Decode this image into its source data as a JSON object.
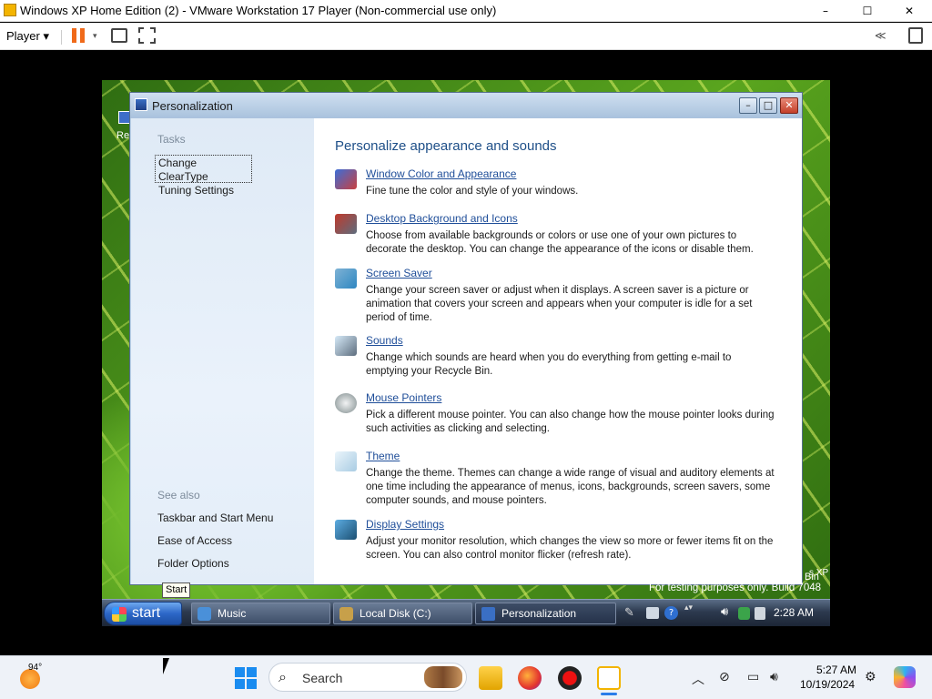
{
  "host_window": {
    "title": "Windows XP Home Edition (2) - VMware Workstation 17 Player (Non-commercial use only)",
    "minimize_glyph": "–",
    "maximize_glyph": "☐",
    "close_glyph": "✕",
    "player_menu": "Player",
    "player_menu_arrow": "▾"
  },
  "toolbar_icons": [
    "pause-icon",
    "send-ctrl-alt-del-icon",
    "fit-guest-icon",
    "unity-icon",
    "library-icon"
  ],
  "guest": {
    "desktop_icon_label": "Re",
    "window": {
      "title": "Personalization",
      "buttons": {
        "minimize": "–",
        "maximize": "□",
        "close": "✕"
      },
      "sidebar": {
        "tasks_heading": "Tasks",
        "tasks_link_line1": "Change ClearType",
        "tasks_link_line2": "Tuning Settings",
        "see_also_heading": "See also",
        "see_also": [
          "Taskbar and Start Menu",
          "Ease of Access",
          "Folder Options"
        ]
      },
      "main": {
        "heading": "Personalize appearance and sounds",
        "items": [
          {
            "title": "Window Color and Appearance",
            "desc": "Fine tune the color and style of your windows.",
            "icon": "window-color-icon"
          },
          {
            "title": "Desktop Background and Icons",
            "desc": "Choose from available backgrounds or colors or use one of your own pictures to decorate the desktop. You can change the appearance of the icons or disable them.",
            "icon": "desktop-background-icon"
          },
          {
            "title": "Screen Saver",
            "desc": "Change your screen saver or adjust when it displays. A screen saver is a picture or animation that covers your screen and appears when your computer is idle for a set period of time.",
            "icon": "screen-saver-icon"
          },
          {
            "title": "Sounds",
            "desc": "Change which sounds are heard when you do everything from getting e-mail to emptying your Recycle Bin.",
            "icon": "sounds-icon"
          },
          {
            "title": "Mouse Pointers",
            "desc": "Pick a different mouse pointer. You can also change how the mouse pointer looks during such activities as clicking and selecting.",
            "icon": "mouse-pointers-icon"
          },
          {
            "title": "Theme",
            "desc": "Change the theme. Themes can change a wide range of visual and auditory elements at one time including the appearance of menus, icons, backgrounds, screen savers, some computer sounds, and mouse pointers.",
            "icon": "theme-icon"
          },
          {
            "title": "Display Settings",
            "desc": "Adjust your monitor resolution, which changes the view so more or fewer items fit on the screen. You can also control monitor flicker (refresh rate).",
            "icon": "display-settings-icon"
          }
        ]
      }
    },
    "watermark": "For testing purposes only. Build 7048",
    "watermark_bin": "Bin",
    "watermark_xp": "s XP",
    "taskbar": {
      "start_label": "start",
      "start_tooltip": "Start",
      "tasks": [
        "Music",
        "Local Disk (C:)",
        "Personalization"
      ],
      "clock": "2:28 AM"
    }
  },
  "host_taskbar": {
    "weather_temp": "94°",
    "search_placeholder": "Search",
    "time": "5:27 AM",
    "date": "10/19/2024"
  },
  "colors": {
    "link_blue": "#1f4e99",
    "heading_blue": "#1e4f88",
    "xp_start_green": "#2d67c8"
  }
}
